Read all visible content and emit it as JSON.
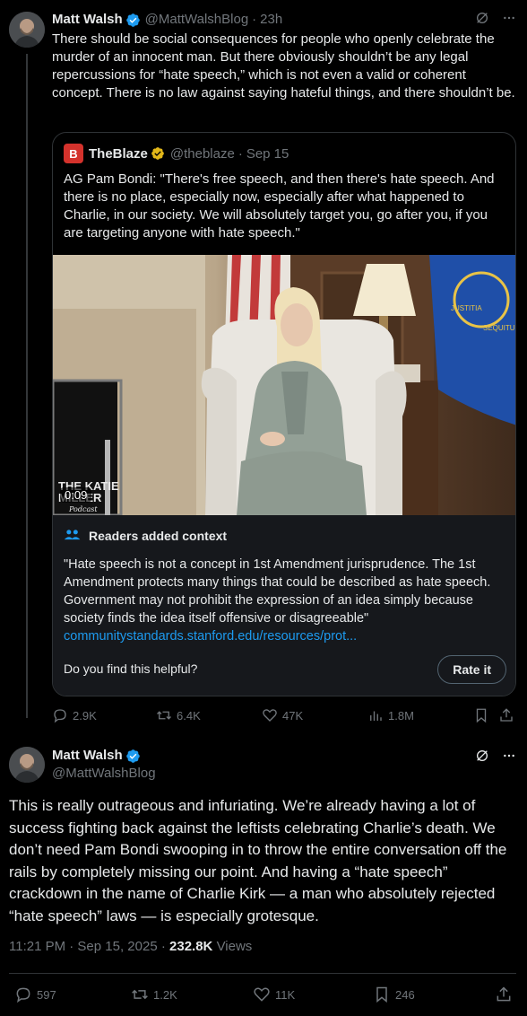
{
  "tweet1": {
    "name": "Matt Walsh",
    "handle": "@MattWalshBlog",
    "separator": "·",
    "time": "23h",
    "text": "There should be social consequences for people who openly celebrate the murder of an innocent man. But there obviously shouldn’t be any legal repercussions for “hate speech,” which is not even a valid or coherent concept. There is no law against saying hateful things, and there shouldn’t be.",
    "quote": {
      "logo_letter": "B",
      "name": "TheBlaze",
      "handle": "@theblaze",
      "separator": "·",
      "date": "Sep 15",
      "text": "AG Pam Bondi: \"There's free speech, and then there's hate speech. And there is no place, especially now, especially after what happened to Charlie, in our society. We will absolutely target you, go after you, if you are targeting anyone with hate speech.\"",
      "video_time": "0:09",
      "watermark_line1": "THE KATIE",
      "watermark_line2": "MILLER",
      "watermark_line3": "Podcast",
      "flag_seal_words": [
        "JUSTITIA",
        "SEQUITUR"
      ]
    },
    "context": {
      "title": "Readers added context",
      "text": "\"Hate speech is not a concept in 1st Amendment jurisprudence. The 1st Amendment protects many things that could be described as hate speech. Government may not prohibit the expression of an idea simply because society finds the idea itself offensive or disagreeable\"",
      "link": "communitystandards.stanford.edu/resources/prot...",
      "question": "Do you find this helpful?",
      "rate_label": "Rate it"
    },
    "actions": {
      "replies": "2.9K",
      "reposts": "6.4K",
      "likes": "47K",
      "views": "1.8M"
    }
  },
  "tweet2": {
    "name": "Matt Walsh",
    "handle": "@MattWalshBlog",
    "text": "This is really outrageous and infuriating. We’re already having a lot of success fighting back against the leftists celebrating Charlie’s death. We don’t need Pam Bondi swooping in to throw the entire conversation off the rails by completely missing our point. And having a “hate speech” crackdown in the name of Charlie Kirk — a man who absolutely rejected “hate speech” laws — is especially grotesque.",
    "time": "11:21 PM · Sep 15, 2025",
    "meta_separator": "·",
    "views_count": "232.8K",
    "views_label": "Views",
    "actions": {
      "replies": "597",
      "reposts": "1.2K",
      "likes": "11K",
      "bookmarks": "246"
    }
  },
  "colors": {
    "background": "#000000",
    "text": "#e7e9ea",
    "muted": "#71767b",
    "link": "#1d9bf0",
    "verified": "#1d9bf0",
    "gold_badge": "#e2b719",
    "blaze_red": "#d4322c"
  },
  "icons": [
    "grok-icon",
    "more-icon",
    "verified-badge-icon",
    "gold-badge-icon",
    "people-icon",
    "reply-icon",
    "repost-icon",
    "like-icon",
    "views-icon",
    "bookmark-icon",
    "share-icon"
  ]
}
